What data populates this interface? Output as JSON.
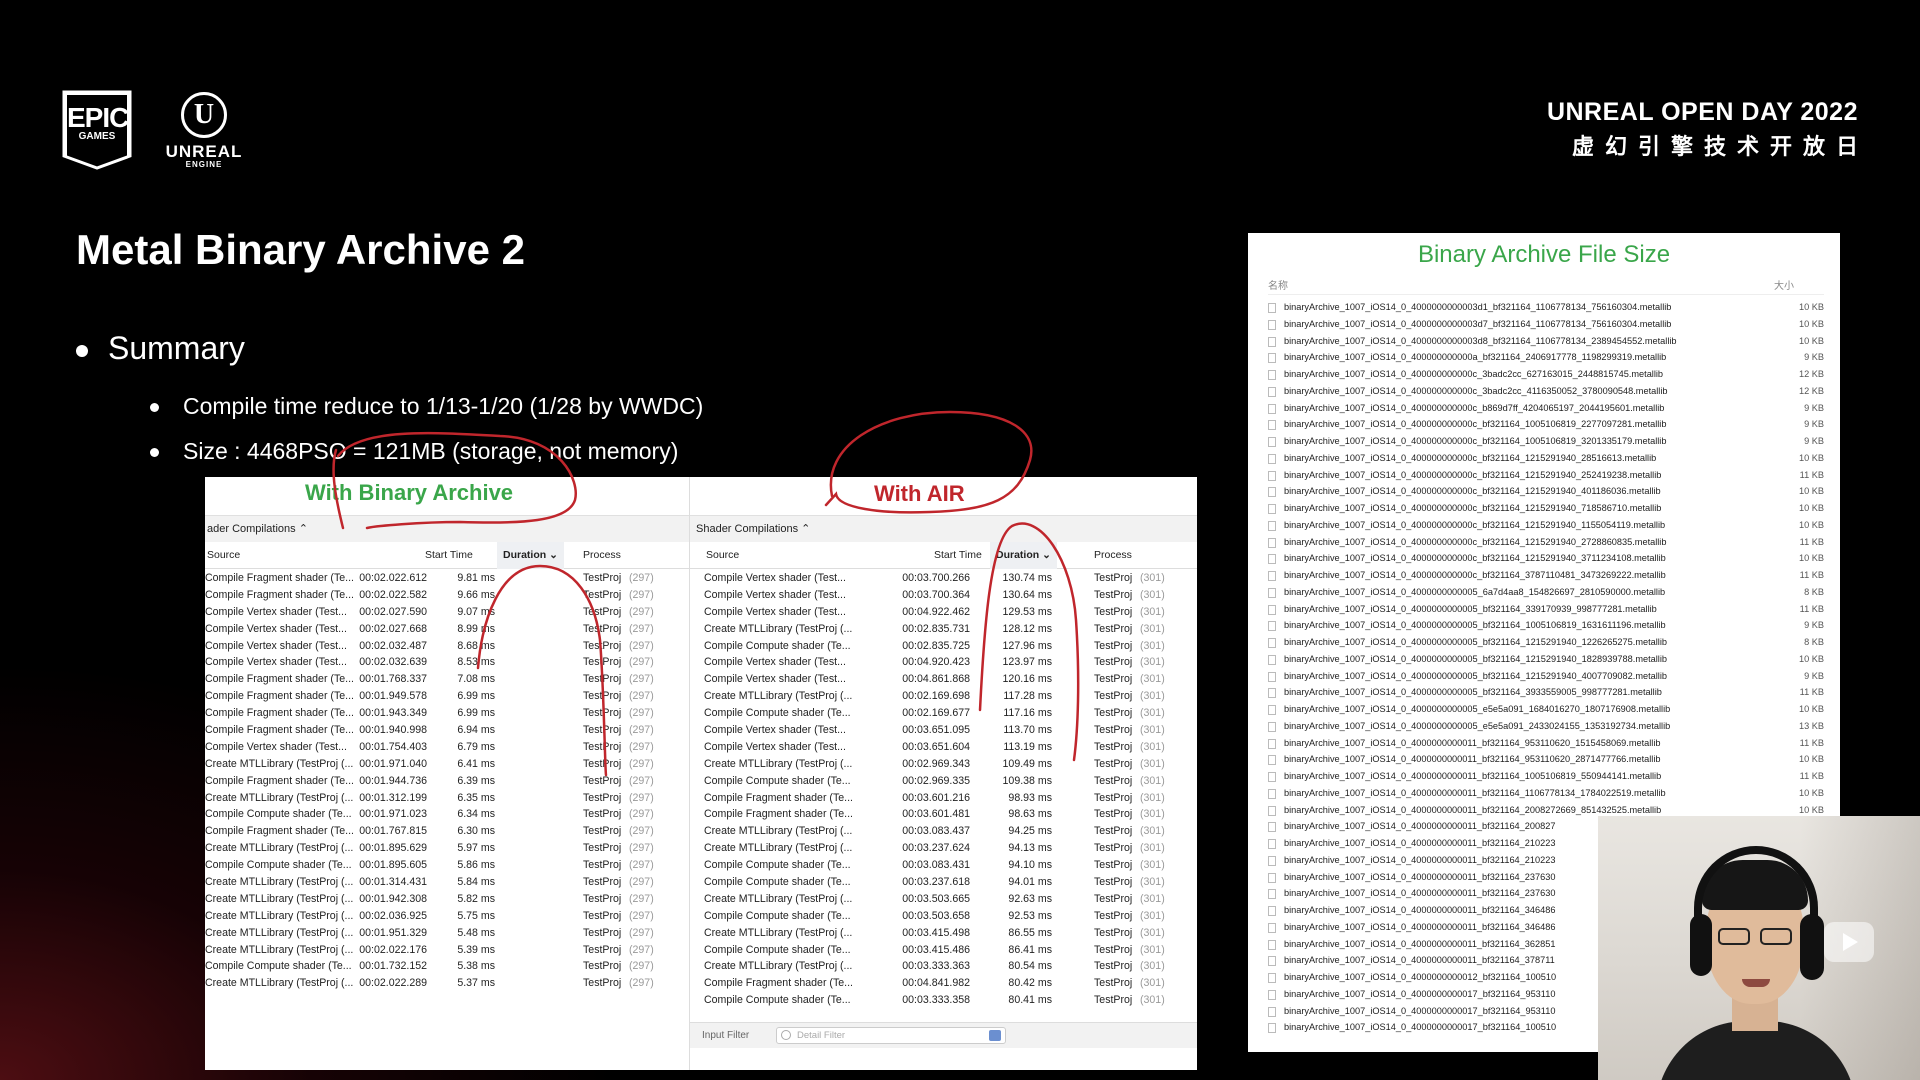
{
  "brand": {
    "epic_big": "EPIC",
    "epic_small": "GAMES",
    "ue_mark": "U",
    "ue_word": "UNREAL",
    "ue_sub": "ENGINE"
  },
  "event": {
    "title_en": "UNREAL OPEN DAY 2022",
    "title_cn": "虚幻引擎技术开放日"
  },
  "slide": {
    "title": "Metal Binary Archive 2",
    "summary_label": "Summary",
    "bullets": [
      "Compile time reduce to 1/13-1/20 (1/28 by WWDC)",
      "Size : 4468PSO = 121MB (storage, not memory)"
    ]
  },
  "left_table": {
    "caption": "With Binary Archive",
    "toolbar": "ader Compilations ⌃",
    "headers": {
      "source": "Source",
      "start": "Start Time",
      "duration": "Duration ⌄",
      "process": "Process"
    },
    "rows": [
      [
        "Compile Fragment shader (Te...",
        "00:02.022.612",
        "9.81 ms",
        "TestProj",
        "(297)"
      ],
      [
        "Compile Fragment shader (Te...",
        "00:02.022.582",
        "9.66 ms",
        "TestProj",
        "(297)"
      ],
      [
        "Compile Vertex shader (Test...",
        "00:02.027.590",
        "9.07 ms",
        "TestProj",
        "(297)"
      ],
      [
        "Compile Vertex shader (Test...",
        "00:02.027.668",
        "8.99 ms",
        "TestProj",
        "(297)"
      ],
      [
        "Compile Vertex shader (Test...",
        "00:02.032.487",
        "8.68 ms",
        "TestProj",
        "(297)"
      ],
      [
        "Compile Vertex shader (Test...",
        "00:02.032.639",
        "8.53 ms",
        "TestProj",
        "(297)"
      ],
      [
        "Compile Fragment shader (Te...",
        "00:01.768.337",
        "7.08 ms",
        "TestProj",
        "(297)"
      ],
      [
        "Compile Fragment shader (Te...",
        "00:01.949.578",
        "6.99 ms",
        "TestProj",
        "(297)"
      ],
      [
        "Compile Fragment shader (Te...",
        "00:01.943.349",
        "6.99 ms",
        "TestProj",
        "(297)"
      ],
      [
        "Compile Fragment shader (Te...",
        "00:01.940.998",
        "6.94 ms",
        "TestProj",
        "(297)"
      ],
      [
        "Compile Vertex shader (Test...",
        "00:01.754.403",
        "6.79 ms",
        "TestProj",
        "(297)"
      ],
      [
        "Create MTLLibrary (TestProj (...",
        "00:01.971.040",
        "6.41 ms",
        "TestProj",
        "(297)"
      ],
      [
        "Compile Fragment shader (Te...",
        "00:01.944.736",
        "6.39 ms",
        "TestProj",
        "(297)"
      ],
      [
        "Create MTLLibrary (TestProj (...",
        "00:01.312.199",
        "6.35 ms",
        "TestProj",
        "(297)"
      ],
      [
        "Compile Compute shader (Te...",
        "00:01.971.023",
        "6.34 ms",
        "TestProj",
        "(297)"
      ],
      [
        "Compile Fragment shader (Te...",
        "00:01.767.815",
        "6.30 ms",
        "TestProj",
        "(297)"
      ],
      [
        "Create MTLLibrary (TestProj (...",
        "00:01.895.629",
        "5.97 ms",
        "TestProj",
        "(297)"
      ],
      [
        "Compile Compute shader (Te...",
        "00:01.895.605",
        "5.86 ms",
        "TestProj",
        "(297)"
      ],
      [
        "Create MTLLibrary (TestProj (...",
        "00:01.314.431",
        "5.84 ms",
        "TestProj",
        "(297)"
      ],
      [
        "Create MTLLibrary (TestProj (...",
        "00:01.942.308",
        "5.82 ms",
        "TestProj",
        "(297)"
      ],
      [
        "Create MTLLibrary (TestProj (...",
        "00:02.036.925",
        "5.75 ms",
        "TestProj",
        "(297)"
      ],
      [
        "Create MTLLibrary (TestProj (...",
        "00:01.951.329",
        "5.48 ms",
        "TestProj",
        "(297)"
      ],
      [
        "Create MTLLibrary (TestProj (...",
        "00:02.022.176",
        "5.39 ms",
        "TestProj",
        "(297)"
      ],
      [
        "Compile Compute shader (Te...",
        "00:01.732.152",
        "5.38 ms",
        "TestProj",
        "(297)"
      ],
      [
        "Create MTLLibrary (TestProj (...",
        "00:02.022.289",
        "5.37 ms",
        "TestProj",
        "(297)"
      ]
    ]
  },
  "right_table": {
    "caption": "With AIR",
    "toolbar": "Shader Compilations ⌃",
    "headers": {
      "source": "Source",
      "start": "Start Time",
      "duration": "Duration ⌄",
      "process": "Process"
    },
    "rows": [
      [
        "Compile Vertex shader (Test...",
        "00:03.700.266",
        "130.74 ms",
        "TestProj",
        "(301)"
      ],
      [
        "Compile Vertex shader (Test...",
        "00:03.700.364",
        "130.64 ms",
        "TestProj",
        "(301)"
      ],
      [
        "Compile Vertex shader (Test...",
        "00:04.922.462",
        "129.53 ms",
        "TestProj",
        "(301)"
      ],
      [
        "Create MTLLibrary (TestProj (...",
        "00:02.835.731",
        "128.12 ms",
        "TestProj",
        "(301)"
      ],
      [
        "Compile Compute shader (Te...",
        "00:02.835.725",
        "127.96 ms",
        "TestProj",
        "(301)"
      ],
      [
        "Compile Vertex shader (Test...",
        "00:04.920.423",
        "123.97 ms",
        "TestProj",
        "(301)"
      ],
      [
        "Compile Vertex shader (Test...",
        "00:04.861.868",
        "120.16 ms",
        "TestProj",
        "(301)"
      ],
      [
        "Create MTLLibrary (TestProj (...",
        "00:02.169.698",
        "117.28 ms",
        "TestProj",
        "(301)"
      ],
      [
        "Compile Compute shader (Te...",
        "00:02.169.677",
        "117.16 ms",
        "TestProj",
        "(301)"
      ],
      [
        "Compile Vertex shader (Test...",
        "00:03.651.095",
        "113.70 ms",
        "TestProj",
        "(301)"
      ],
      [
        "Compile Vertex shader (Test...",
        "00:03.651.604",
        "113.19 ms",
        "TestProj",
        "(301)"
      ],
      [
        "Create MTLLibrary (TestProj (...",
        "00:02.969.343",
        "109.49 ms",
        "TestProj",
        "(301)"
      ],
      [
        "Compile Compute shader (Te...",
        "00:02.969.335",
        "109.38 ms",
        "TestProj",
        "(301)"
      ],
      [
        "Compile Fragment shader (Te...",
        "00:03.601.216",
        "98.93 ms",
        "TestProj",
        "(301)"
      ],
      [
        "Compile Fragment shader (Te...",
        "00:03.601.481",
        "98.63 ms",
        "TestProj",
        "(301)"
      ],
      [
        "Create MTLLibrary (TestProj (...",
        "00:03.083.437",
        "94.25 ms",
        "TestProj",
        "(301)"
      ],
      [
        "Create MTLLibrary (TestProj (...",
        "00:03.237.624",
        "94.13 ms",
        "TestProj",
        "(301)"
      ],
      [
        "Compile Compute shader (Te...",
        "00:03.083.431",
        "94.10 ms",
        "TestProj",
        "(301)"
      ],
      [
        "Compile Compute shader (Te...",
        "00:03.237.618",
        "94.01 ms",
        "TestProj",
        "(301)"
      ],
      [
        "Create MTLLibrary (TestProj (...",
        "00:03.503.665",
        "92.63 ms",
        "TestProj",
        "(301)"
      ],
      [
        "Compile Compute shader (Te...",
        "00:03.503.658",
        "92.53 ms",
        "TestProj",
        "(301)"
      ],
      [
        "Create MTLLibrary (TestProj (...",
        "00:03.415.498",
        "86.55 ms",
        "TestProj",
        "(301)"
      ],
      [
        "Compile Compute shader (Te...",
        "00:03.415.486",
        "86.41 ms",
        "TestProj",
        "(301)"
      ],
      [
        "Create MTLLibrary (TestProj (...",
        "00:03.333.363",
        "80.54 ms",
        "TestProj",
        "(301)"
      ],
      [
        "Compile Fragment shader (Te...",
        "00:04.841.982",
        "80.42 ms",
        "TestProj",
        "(301)"
      ],
      [
        "Compile Compute shader (Te...",
        "00:03.333.358",
        "80.41 ms",
        "TestProj",
        "(301)"
      ]
    ],
    "input_filter_label": "Input Filter",
    "detail_filter_placeholder": "Detail Filter"
  },
  "file_size": {
    "title": "Binary Archive File Size",
    "col_name": "名称",
    "col_size": "大小",
    "rows": [
      [
        "binaryArchive_1007_iOS14_0_4000000000003d1_bf321164_1106778134_756160304.metallib",
        "10 KB"
      ],
      [
        "binaryArchive_1007_iOS14_0_4000000000003d7_bf321164_1106778134_756160304.metallib",
        "10 KB"
      ],
      [
        "binaryArchive_1007_iOS14_0_4000000000003d8_bf321164_1106778134_2389454552.metallib",
        "10 KB"
      ],
      [
        "binaryArchive_1007_iOS14_0_400000000000a_bf321164_2406917778_1198299319.metallib",
        "9 KB"
      ],
      [
        "binaryArchive_1007_iOS14_0_400000000000c_3badc2cc_627163015_2448815745.metallib",
        "12 KB"
      ],
      [
        "binaryArchive_1007_iOS14_0_400000000000c_3badc2cc_4116350052_3780090548.metallib",
        "12 KB"
      ],
      [
        "binaryArchive_1007_iOS14_0_400000000000c_b869d7ff_4204065197_2044195601.metallib",
        "9 KB"
      ],
      [
        "binaryArchive_1007_iOS14_0_400000000000c_bf321164_1005106819_2277097281.metallib",
        "9 KB"
      ],
      [
        "binaryArchive_1007_iOS14_0_400000000000c_bf321164_1005106819_3201335179.metallib",
        "9 KB"
      ],
      [
        "binaryArchive_1007_iOS14_0_400000000000c_bf321164_1215291940_28516613.metallib",
        "10 KB"
      ],
      [
        "binaryArchive_1007_iOS14_0_400000000000c_bf321164_1215291940_252419238.metallib",
        "11 KB"
      ],
      [
        "binaryArchive_1007_iOS14_0_400000000000c_bf321164_1215291940_401186036.metallib",
        "10 KB"
      ],
      [
        "binaryArchive_1007_iOS14_0_400000000000c_bf321164_1215291940_718586710.metallib",
        "10 KB"
      ],
      [
        "binaryArchive_1007_iOS14_0_400000000000c_bf321164_1215291940_1155054119.metallib",
        "10 KB"
      ],
      [
        "binaryArchive_1007_iOS14_0_400000000000c_bf321164_1215291940_2728860835.metallib",
        "11 KB"
      ],
      [
        "binaryArchive_1007_iOS14_0_400000000000c_bf321164_1215291940_3711234108.metallib",
        "10 KB"
      ],
      [
        "binaryArchive_1007_iOS14_0_400000000000c_bf321164_3787110481_3473269222.metallib",
        "11 KB"
      ],
      [
        "binaryArchive_1007_iOS14_0_4000000000005_6a7d4aa8_154826697_2810590000.metallib",
        "8 KB"
      ],
      [
        "binaryArchive_1007_iOS14_0_4000000000005_bf321164_339170939_998777281.metallib",
        "11 KB"
      ],
      [
        "binaryArchive_1007_iOS14_0_4000000000005_bf321164_1005106819_1631611196.metallib",
        "9 KB"
      ],
      [
        "binaryArchive_1007_iOS14_0_4000000000005_bf321164_1215291940_1226265275.metallib",
        "8 KB"
      ],
      [
        "binaryArchive_1007_iOS14_0_4000000000005_bf321164_1215291940_1828939788.metallib",
        "10 KB"
      ],
      [
        "binaryArchive_1007_iOS14_0_4000000000005_bf321164_1215291940_4007709082.metallib",
        "9 KB"
      ],
      [
        "binaryArchive_1007_iOS14_0_4000000000005_bf321164_3933559005_998777281.metallib",
        "11 KB"
      ],
      [
        "binaryArchive_1007_iOS14_0_4000000000005_e5e5a091_1684016270_1807176908.metallib",
        "10 KB"
      ],
      [
        "binaryArchive_1007_iOS14_0_4000000000005_e5e5a091_2433024155_1353192734.metallib",
        "13 KB"
      ],
      [
        "binaryArchive_1007_iOS14_0_4000000000011_bf321164_953110620_1515458069.metallib",
        "11 KB"
      ],
      [
        "binaryArchive_1007_iOS14_0_4000000000011_bf321164_953110620_2871477766.metallib",
        "10 KB"
      ],
      [
        "binaryArchive_1007_iOS14_0_4000000000011_bf321164_1005106819_550944141.metallib",
        "11 KB"
      ],
      [
        "binaryArchive_1007_iOS14_0_4000000000011_bf321164_1106778134_1784022519.metallib",
        "10 KB"
      ],
      [
        "binaryArchive_1007_iOS14_0_4000000000011_bf321164_2008272669_851432525.metallib",
        "10 KB"
      ],
      [
        "binaryArchive_1007_iOS14_0_4000000000011_bf321164_200827",
        ""
      ],
      [
        "binaryArchive_1007_iOS14_0_4000000000011_bf321164_210223",
        ""
      ],
      [
        "binaryArchive_1007_iOS14_0_4000000000011_bf321164_210223",
        ""
      ],
      [
        "binaryArchive_1007_iOS14_0_4000000000011_bf321164_237630",
        ""
      ],
      [
        "binaryArchive_1007_iOS14_0_4000000000011_bf321164_237630",
        ""
      ],
      [
        "binaryArchive_1007_iOS14_0_4000000000011_bf321164_346486",
        ""
      ],
      [
        "binaryArchive_1007_iOS14_0_4000000000011_bf321164_346486",
        ""
      ],
      [
        "binaryArchive_1007_iOS14_0_4000000000011_bf321164_362851",
        ""
      ],
      [
        "binaryArchive_1007_iOS14_0_4000000000011_bf321164_378711",
        ""
      ],
      [
        "binaryArchive_1007_iOS14_0_4000000000012_bf321164_100510",
        ""
      ],
      [
        "binaryArchive_1007_iOS14_0_4000000000017_bf321164_953110",
        ""
      ],
      [
        "binaryArchive_1007_iOS14_0_4000000000017_bf321164_953110",
        ""
      ],
      [
        "binaryArchive_1007_iOS14_0_4000000000017_bf321164_100510",
        ""
      ]
    ]
  },
  "colors": {
    "green": "#3aa64a",
    "red": "#c0262c",
    "background": "#000000"
  },
  "icons": {
    "play": "play-icon",
    "document": "document-icon",
    "search": "search-icon"
  }
}
